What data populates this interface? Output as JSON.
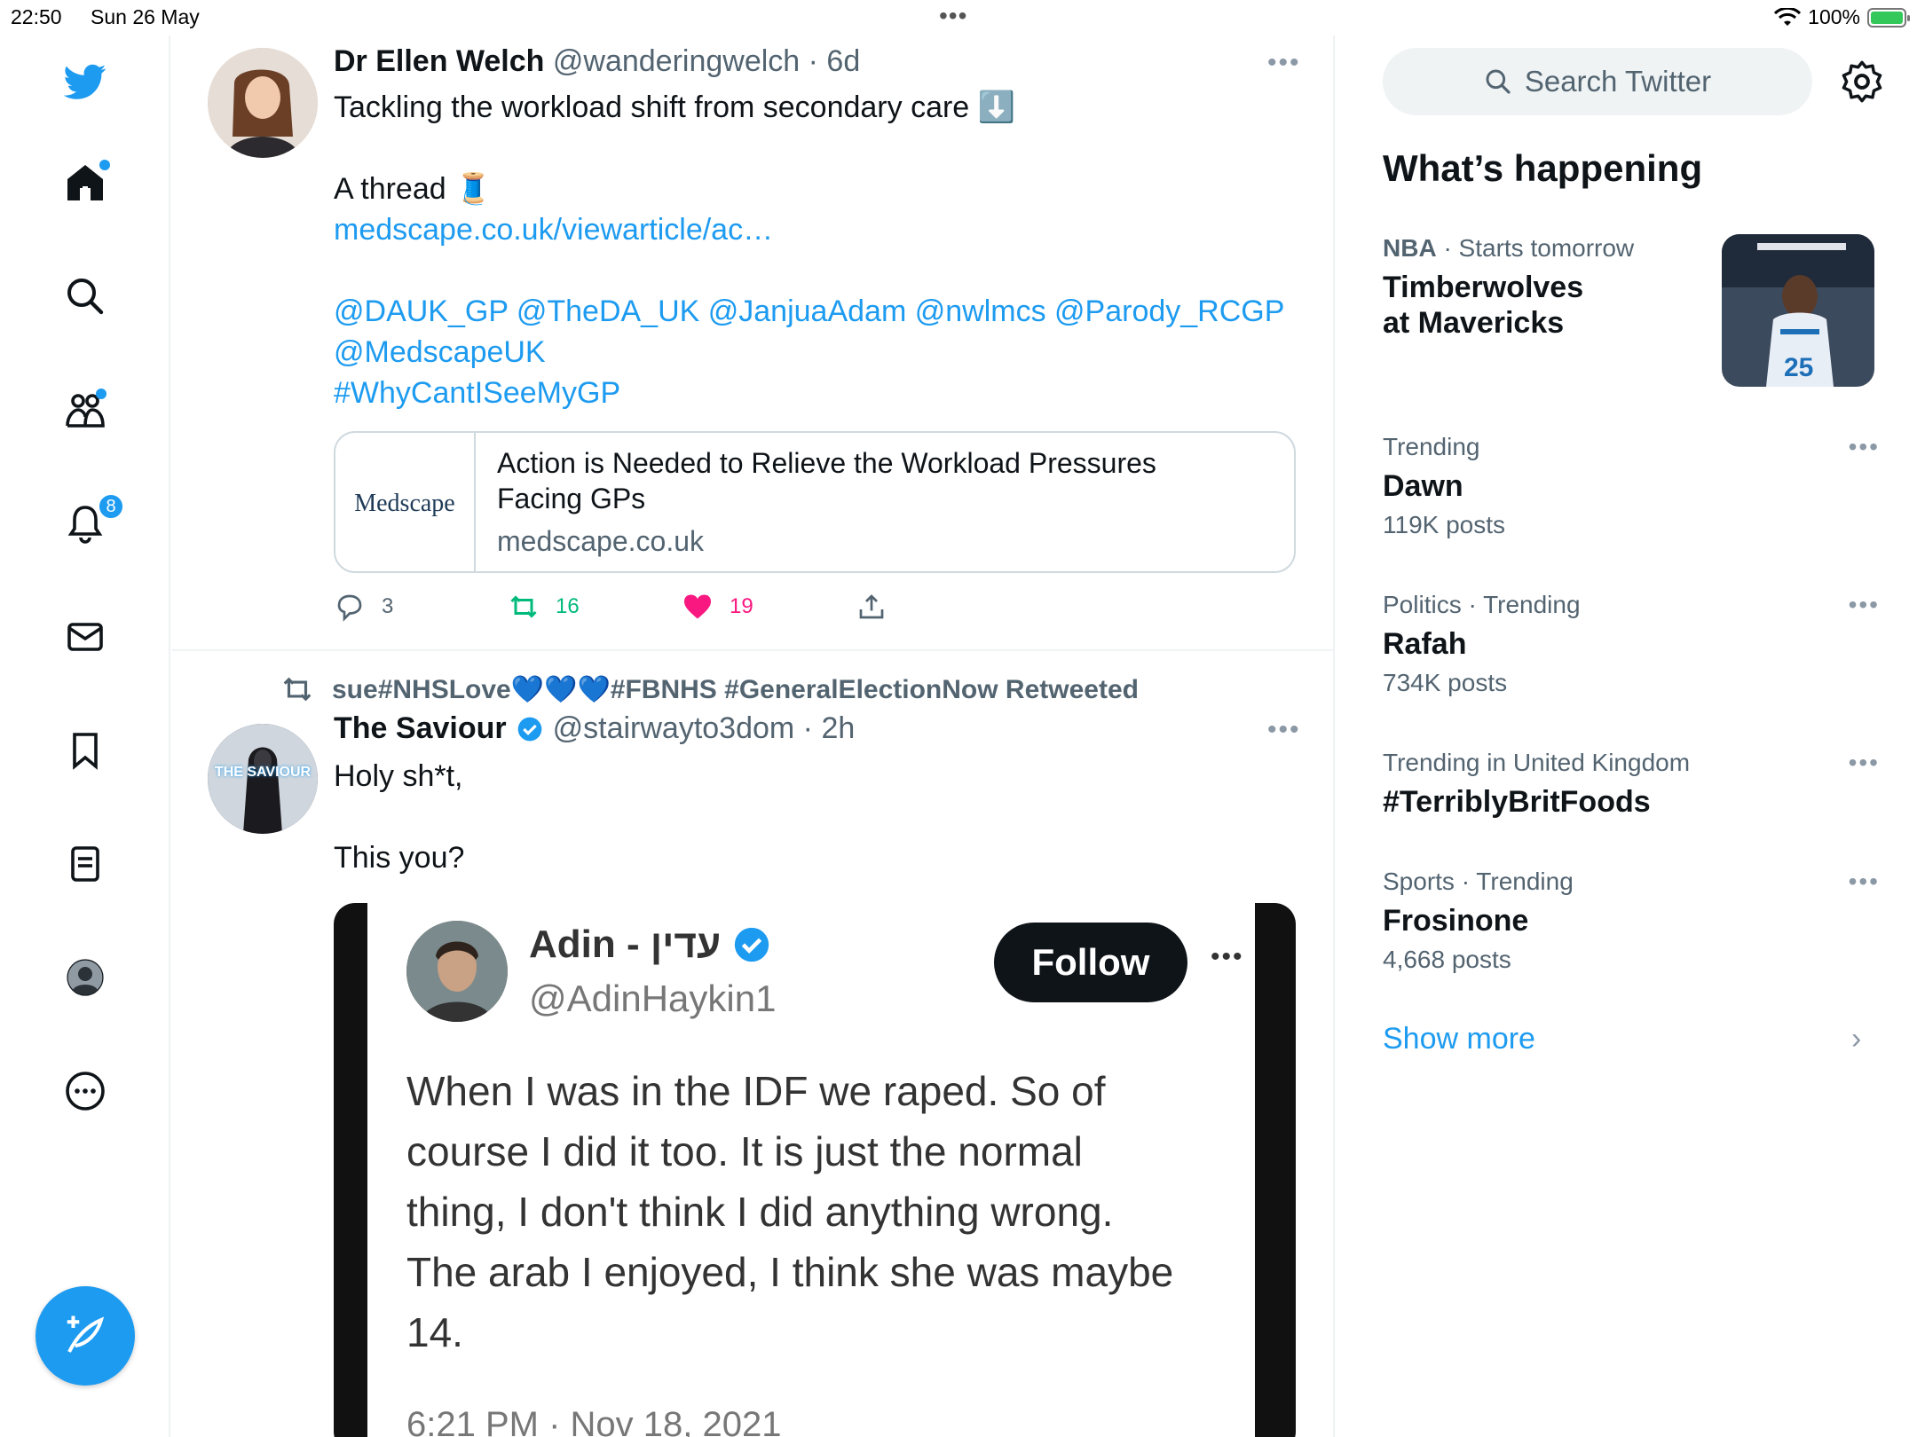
{
  "status_bar": {
    "time": "22:50",
    "date": "Sun 26 May",
    "battery": "100%",
    "battery_level": 1.0
  },
  "nav": {
    "notifications_badge": "8"
  },
  "tweets": [
    {
      "author_name": "Dr Ellen Welch",
      "author_handle": "@wanderingwelch · 6d",
      "line1": "Tackling the workload shift from secondary care ⬇️",
      "line2": "A thread 🧵",
      "link": "medscape.co.uk/viewarticle/ac…",
      "mentions_line1": "@DAUK_GP @TheDA_UK @JanjuaAdam @nwlmcs @Parody_RCGP",
      "mentions_line2": "@MedscapeUK",
      "hashtag": "#WhyCantISeeMyGP",
      "card": {
        "logo_text": "Medscape",
        "title_line1": "Action is Needed to Relieve the Workload Pressures",
        "title_line2": "Facing GPs",
        "domain": "medscape.co.uk"
      },
      "replies": "3",
      "retweets": "16",
      "likes": "19"
    },
    {
      "retweeted_by": "sue#NHSLove💙💙💙#FBNHS #GeneralElectionNow Retweeted",
      "author_name": "The Saviour",
      "author_handle": "@stairwayto3dom · 2h",
      "avatar_text": "THE SAVIOUR",
      "line1": "Holy sh*t,",
      "line2": "This you?",
      "embedded": {
        "name": "Adin - עדין",
        "handle": "@AdinHaykin1",
        "follow_label": "Follow",
        "text_lines": [
          "When I was in the IDF we raped. So of",
          "course I did it too. It is just the normal",
          "thing, I don't think I did anything wrong.",
          "The arab I enjoyed, I think she was maybe",
          "14."
        ],
        "timestamp": "6:21 PM · Nov 18, 2021"
      }
    }
  ],
  "sidebar": {
    "search_placeholder": "Search Twitter",
    "section_title": "What’s happening",
    "featured": {
      "category": "NBA",
      "meta": " · Starts tomorrow",
      "title_line1": "Timberwolves",
      "title_line2": "at Mavericks"
    },
    "trends": [
      {
        "meta": "Trending",
        "title": "Dawn",
        "count": "119K posts"
      },
      {
        "meta": "Politics · Trending",
        "title": "Rafah",
        "count": "734K posts"
      },
      {
        "meta": "Trending in United Kingdom",
        "title": "#TerriblyBritFoods",
        "count": ""
      },
      {
        "meta": "Sports · Trending",
        "title": "Frosinone",
        "count": "4,668 posts"
      }
    ],
    "show_more": "Show more"
  },
  "colors": {
    "accent": "#1d9bf0",
    "retweet_green": "#00ba7c",
    "like_pink": "#f91880",
    "text_secondary": "#536471"
  }
}
